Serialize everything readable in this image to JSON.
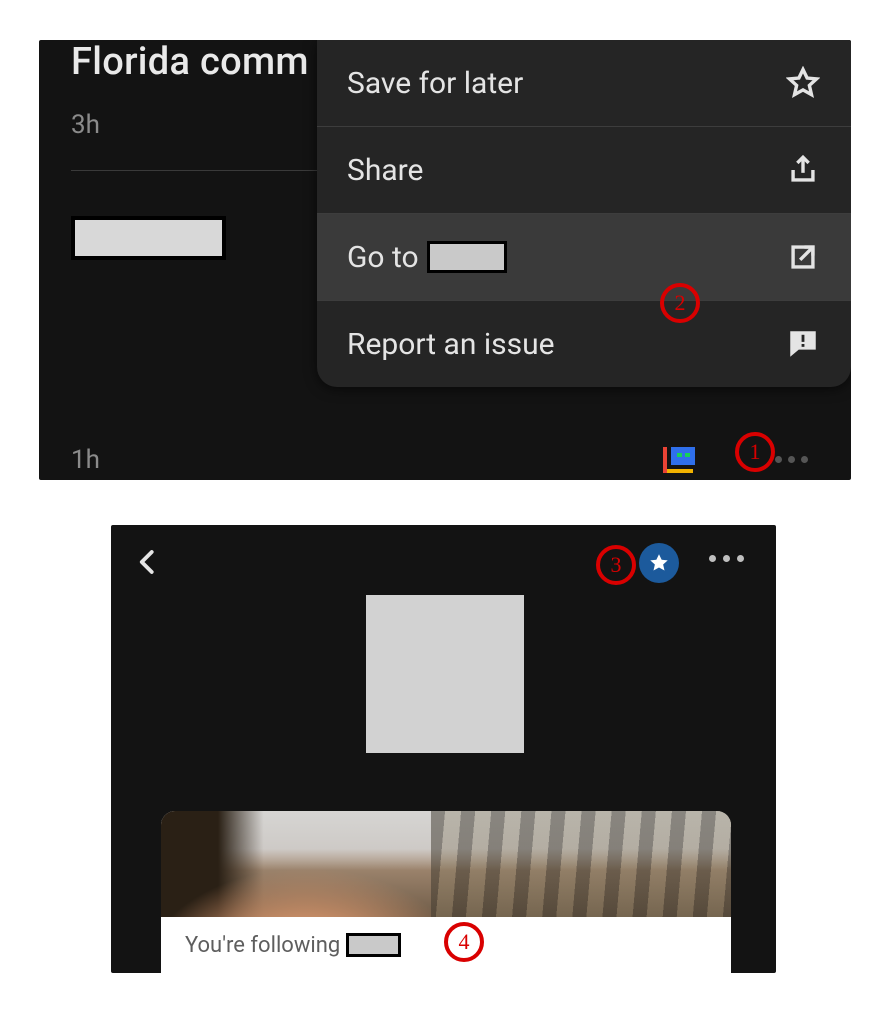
{
  "top": {
    "headline": "Florida comm",
    "time_top": "3h",
    "time_bottom": "1h",
    "menu": {
      "save": "Save for later",
      "share": "Share",
      "goto_prefix": "Go to",
      "report": "Report an issue"
    }
  },
  "bottom": {
    "following_prefix": "You're following"
  },
  "annotations": {
    "n1": "1",
    "n2": "2",
    "n3": "3",
    "n4": "4"
  }
}
